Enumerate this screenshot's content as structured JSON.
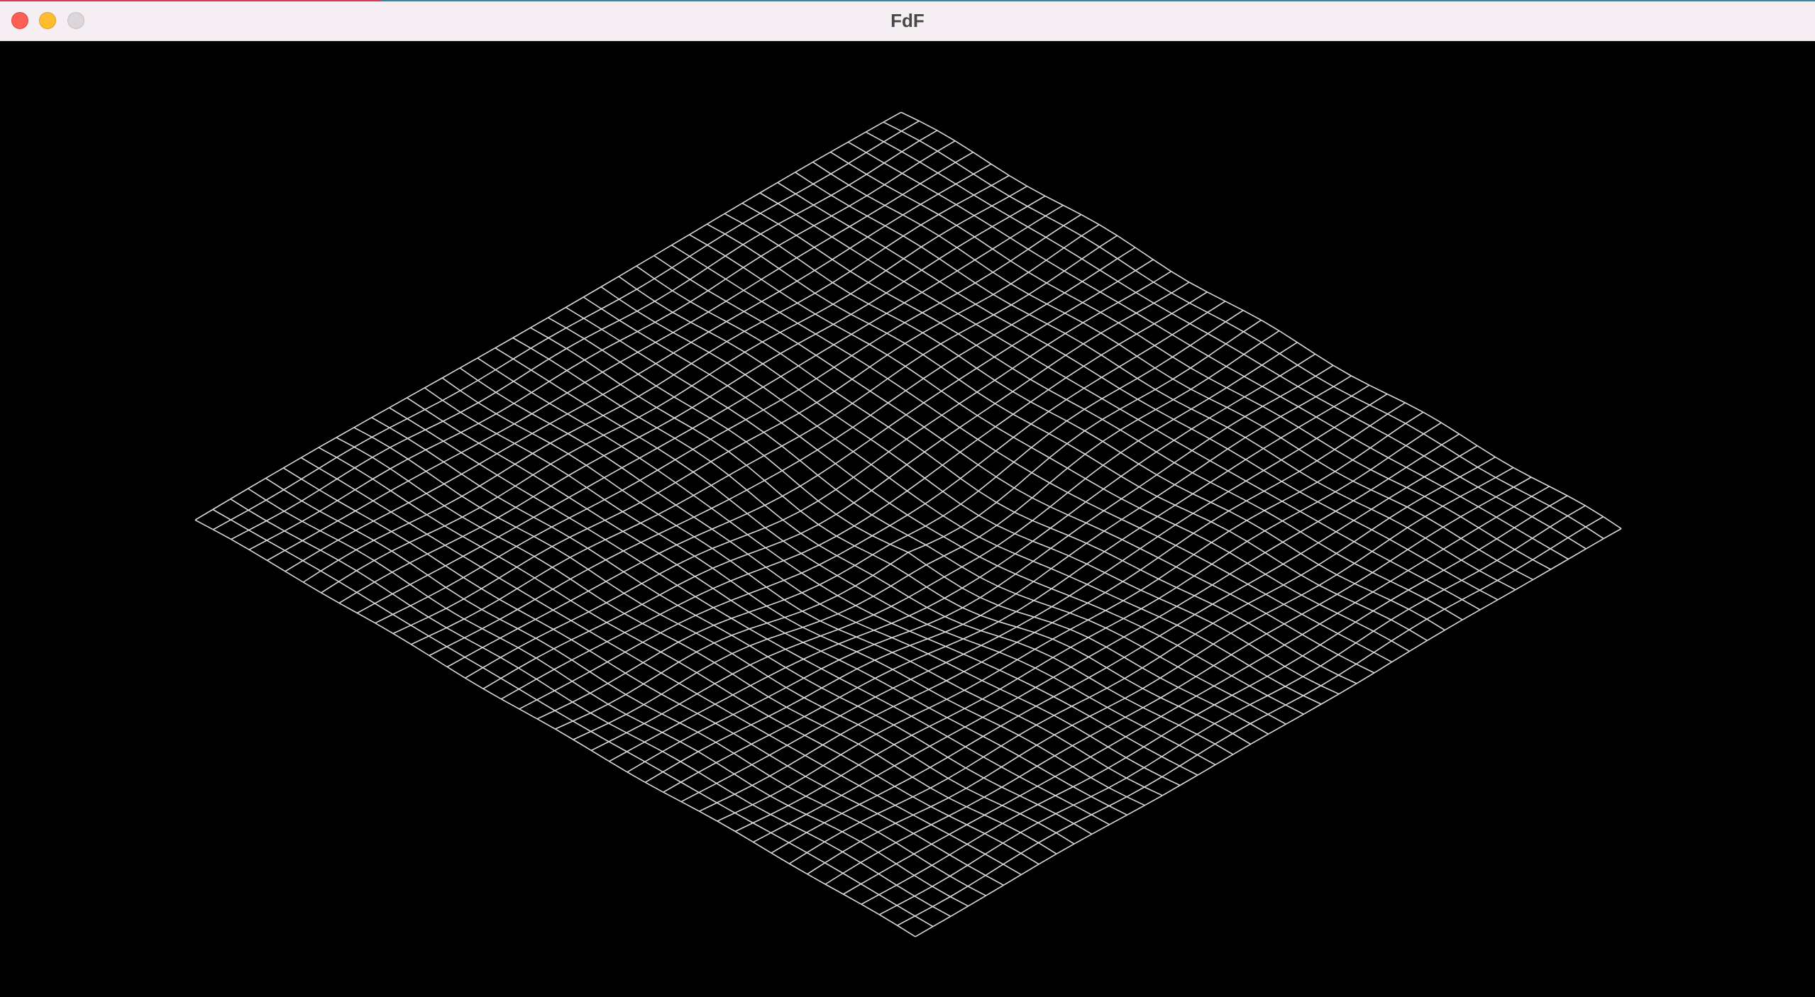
{
  "window": {
    "title": "FdF"
  },
  "colors": {
    "background": "#000000",
    "wire": "#d9d9d9",
    "titlebar": "#f5eef2"
  },
  "icons": {
    "close": "close-icon",
    "minimize": "minimize-icon",
    "zoom": "zoom-icon"
  }
}
